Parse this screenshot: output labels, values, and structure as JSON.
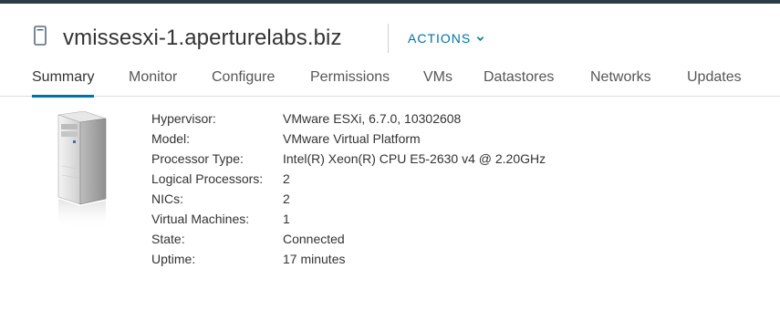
{
  "header": {
    "title": "vmissesxi-1.aperturelabs.biz",
    "actions_label": "ACTIONS"
  },
  "tabs": [
    {
      "label": "Summary",
      "active": true
    },
    {
      "label": "Monitor"
    },
    {
      "label": "Configure"
    },
    {
      "label": "Permissions"
    },
    {
      "label": "VMs"
    },
    {
      "label": "Datastores"
    },
    {
      "label": "Networks"
    },
    {
      "label": "Updates"
    }
  ],
  "summary": {
    "properties": [
      {
        "label": "Hypervisor:",
        "value": "VMware ESXi, 6.7.0, 10302608"
      },
      {
        "label": "Model:",
        "value": "VMware Virtual Platform"
      },
      {
        "label": "Processor Type:",
        "value": "Intel(R) Xeon(R) CPU E5-2630 v4 @ 2.20GHz"
      },
      {
        "label": "Logical Processors:",
        "value": "2"
      },
      {
        "label": "NICs:",
        "value": "2"
      },
      {
        "label": "Virtual Machines:",
        "value": "1"
      },
      {
        "label": "State:",
        "value": "Connected"
      },
      {
        "label": "Uptime:",
        "value": "17 minutes"
      }
    ]
  },
  "colors": {
    "accent": "#0072a3",
    "topbar": "#2b3b47",
    "text": "#333333"
  }
}
